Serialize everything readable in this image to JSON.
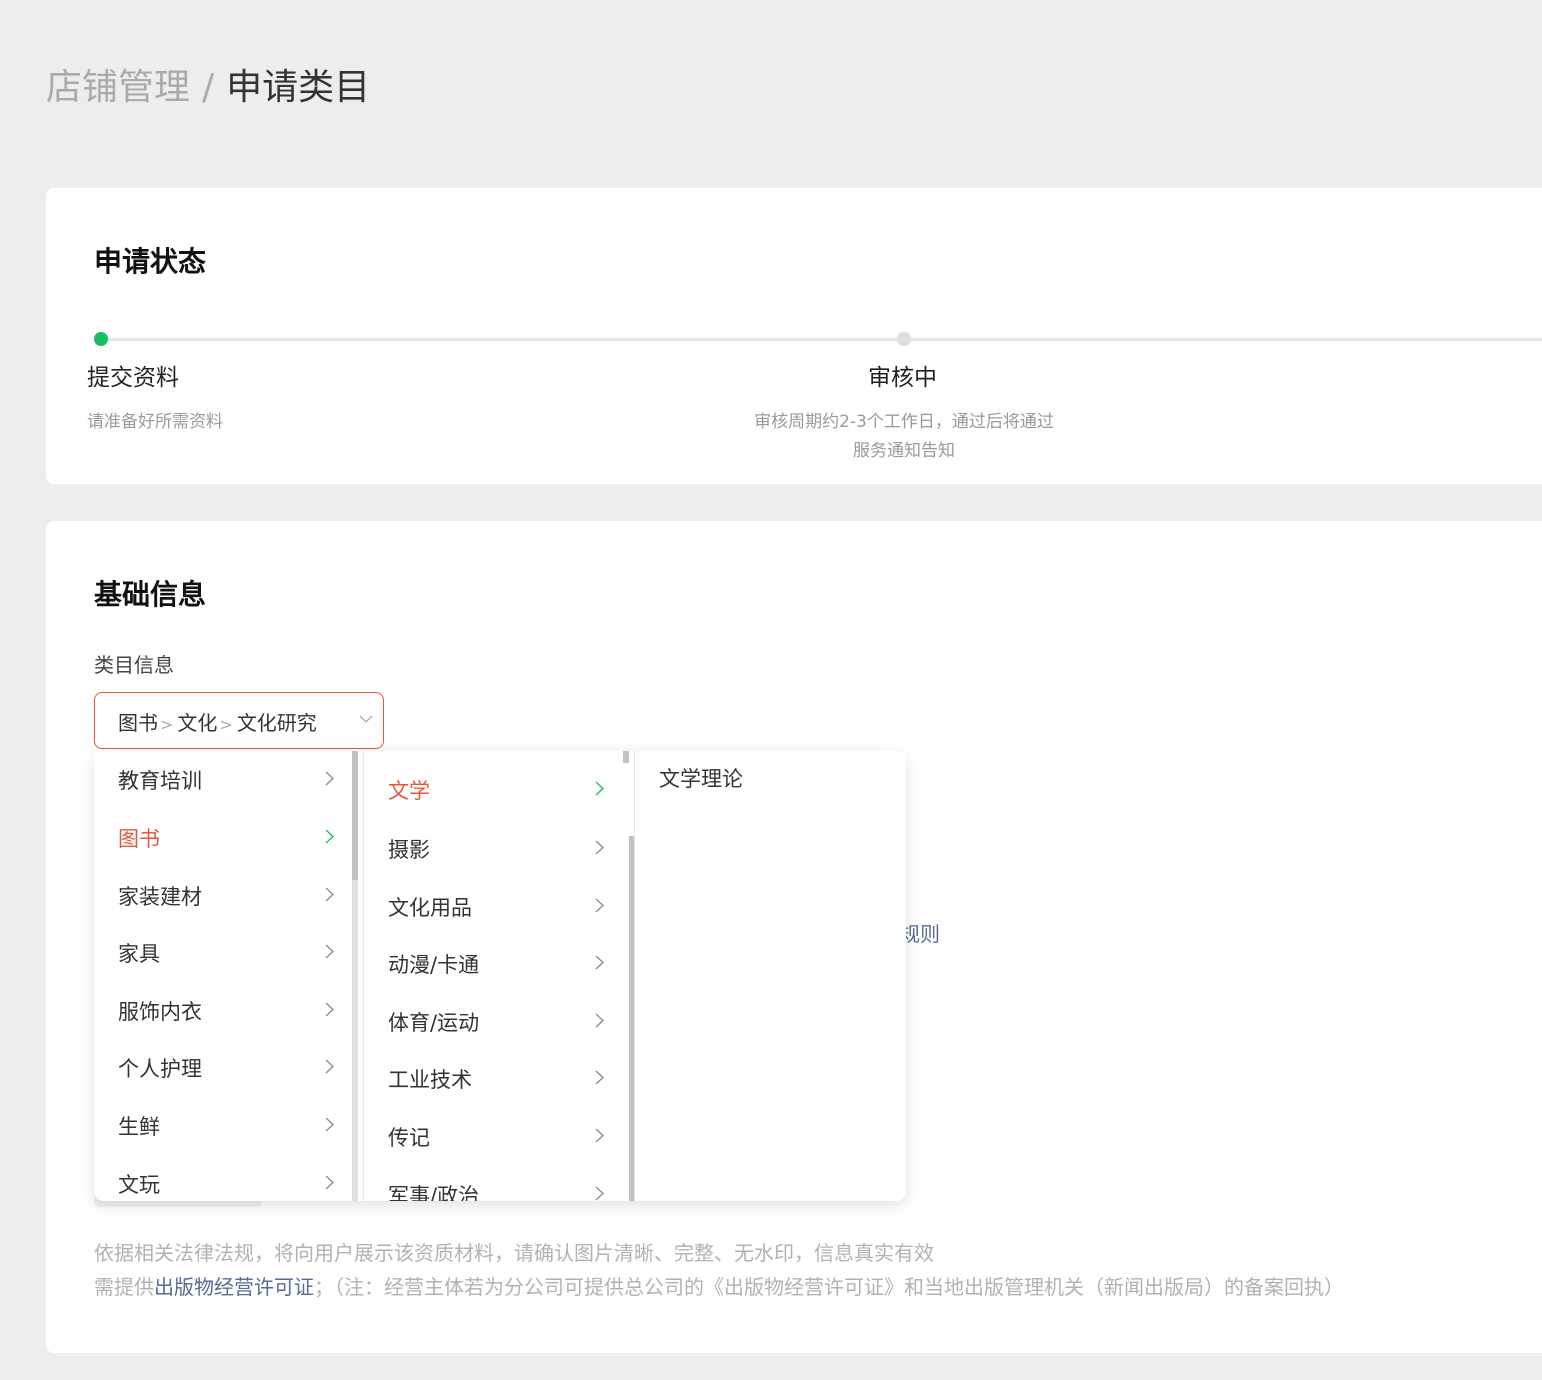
{
  "breadcrumb": {
    "parent": "店铺管理",
    "separator": "/",
    "current": "申请类目"
  },
  "status": {
    "title": "申请状态",
    "steps": [
      {
        "title": "提交资料",
        "desc": "请准备好所需资料",
        "state": "active"
      },
      {
        "title": "审核中",
        "desc": "审核周期约2-3个工作日，通过后将通过服务通知告知",
        "state": "pending"
      }
    ]
  },
  "basic": {
    "title": "基础信息",
    "field_label": "类目信息",
    "selected_path": [
      "图书",
      "文化",
      "文化研究"
    ],
    "hidden_link_fragment": "规则",
    "note1": "依据相关法律法规，将向用户展示该资质材料，请确认图片清晰、完整、无水印，信息真实有效",
    "note2_prefix": "需提供",
    "note2_link": "出版物经营许可证",
    "note2_suffix": "；（注：经营主体若为分公司可提供总公司的《出版物经营许可证》和当地出版管理机关（新闻出版局）的备案回执）"
  },
  "cascader": {
    "level1": [
      {
        "label": "教育培训"
      },
      {
        "label": "图书",
        "active": true
      },
      {
        "label": "家装建材"
      },
      {
        "label": "家具"
      },
      {
        "label": "服饰内衣"
      },
      {
        "label": "个人护理"
      },
      {
        "label": "生鲜"
      },
      {
        "label": "文玩"
      }
    ],
    "level2": [
      {
        "label": "文学",
        "active": true
      },
      {
        "label": "摄影"
      },
      {
        "label": "文化用品"
      },
      {
        "label": "动漫/卡通"
      },
      {
        "label": "体育/运动"
      },
      {
        "label": "工业技术"
      },
      {
        "label": "传记"
      },
      {
        "label": "军事/政治"
      }
    ],
    "level3": [
      {
        "label": "文学理论"
      }
    ]
  },
  "colors": {
    "accent": "#e4593a",
    "success": "#16c060",
    "link": "#576b95",
    "background": "#ededed"
  },
  "icons": {
    "item_arrow": "chevron-right-icon",
    "select_arrow": "chevron-down-icon"
  }
}
